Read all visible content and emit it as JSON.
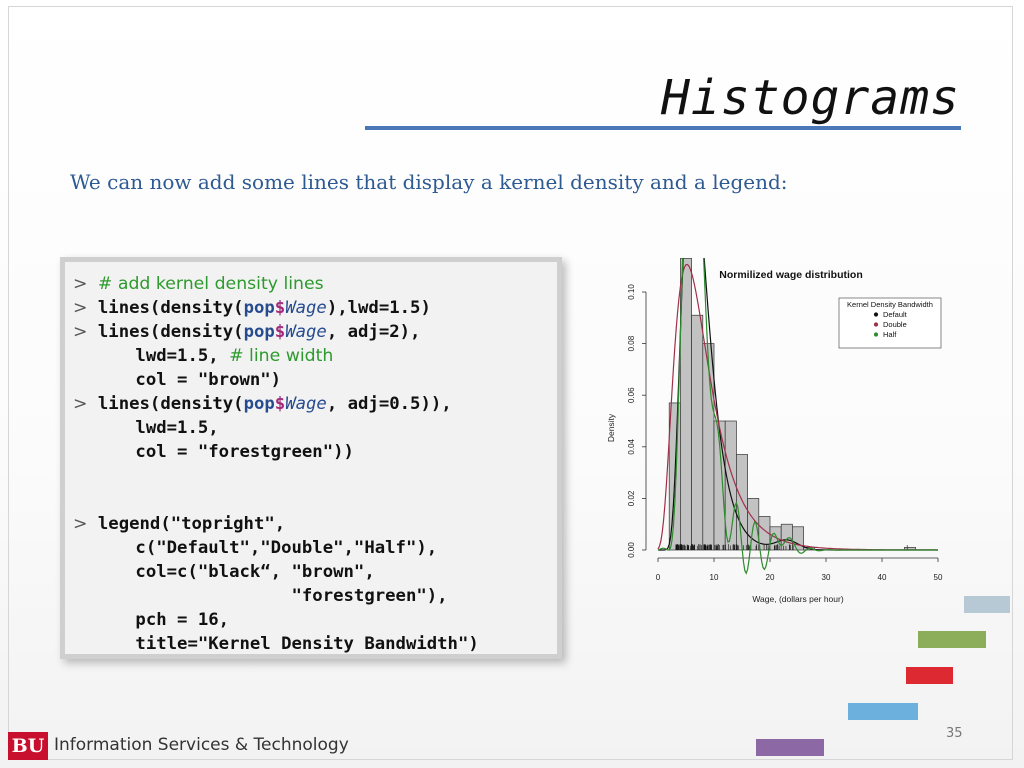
{
  "slide": {
    "title": "Histograms",
    "subtitle": "We can now add some lines that display a kernel density and a legend:",
    "page_number": "35",
    "footer": {
      "logo_text": "BU",
      "organization": "Information Services & Technology"
    }
  },
  "code_prompt": ">",
  "code": {
    "comment1": "# add kernel density lines",
    "l2_a": "lines(density(",
    "pop": "pop",
    "dollar": "$",
    "wage": "Wage",
    "l2_b": "),lwd=1.5)",
    "l3_b": ", adj=2),",
    "l4_a": "    lwd=1.5, ",
    "comment2": "# line width",
    "l5": "    col = \"brown\")",
    "l6_b": ", adj=0.5)),",
    "l7": "    lwd=1.5,",
    "l8": "    col = \"forestgreen\"))",
    "l10": "legend(\"topright\",",
    "l11": "    c(\"Default\",\"Double\",\"Half\"),",
    "l12": "    col=c(\"black“, \"brown\",",
    "l13": "                   \"forestgreen\"),",
    "l14": "    pch = 16,",
    "l15": "    title=\"Kernel Density Bandwidth\")"
  },
  "decor_colors": [
    "#b8c9d6",
    "#8cad5a",
    "#dd2a32",
    "#6cb1de",
    "#8c69a5"
  ],
  "chart_data": {
    "type": "bar",
    "title": "Normilized wage distribution",
    "xlabel": "Wage, (dollars per hour)",
    "ylabel": "Density",
    "xlim": [
      0,
      50
    ],
    "ylim": [
      0,
      0.1
    ],
    "xticks": [
      "0",
      "10",
      "20",
      "30",
      "40",
      "50"
    ],
    "yticks": [
      "0.00",
      "0.02",
      "0.04",
      "0.06",
      "0.08",
      "0.10"
    ],
    "bin_width": 2,
    "bin_starts": [
      2,
      4,
      6,
      8,
      10,
      12,
      14,
      16,
      18,
      20,
      22,
      24,
      26,
      28,
      30,
      32,
      34,
      36,
      38,
      40,
      42,
      44,
      46
    ],
    "values": [
      0.057,
      0.113,
      0.091,
      0.08,
      0.05,
      0.05,
      0.037,
      0.02,
      0.013,
      0.009,
      0.01,
      0.009,
      0.001,
      0.0,
      0.0,
      0.0,
      0.0,
      0.0,
      0.0,
      0.0,
      0.0,
      0.001,
      0.0
    ],
    "legend": {
      "title": "Kernel Density Bandwidth",
      "position": "top-right",
      "entries": [
        {
          "label": "Default",
          "color": "#111111"
        },
        {
          "label": "Double",
          "color": "#a0304a"
        },
        {
          "label": "Half",
          "color": "#2e8b2e"
        }
      ]
    }
  }
}
